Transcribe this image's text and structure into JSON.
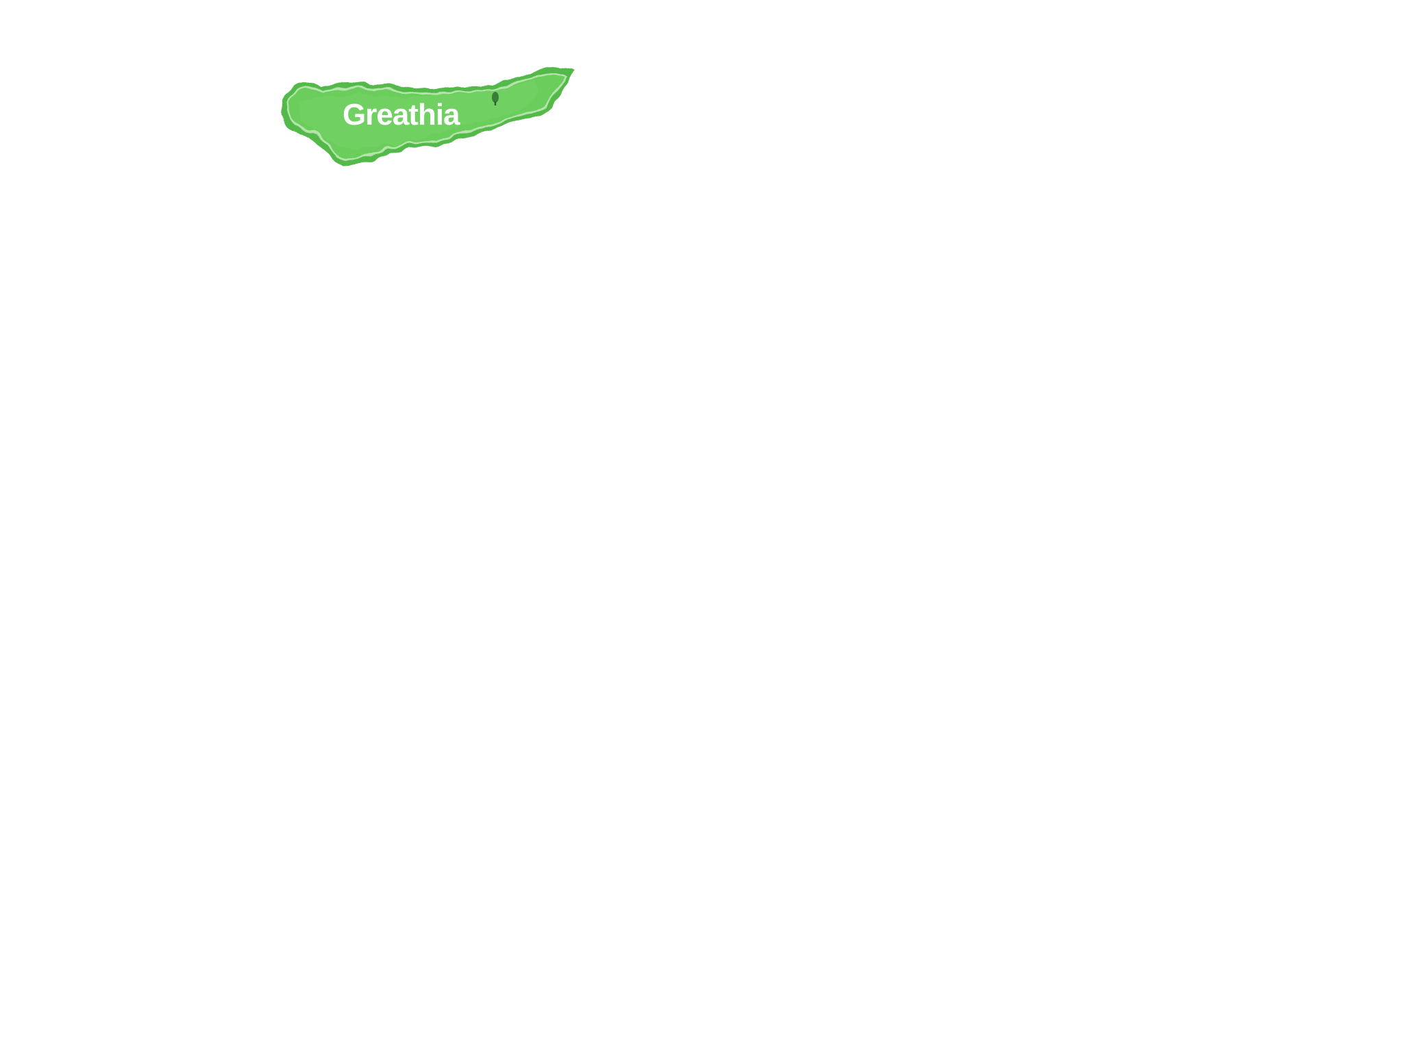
{
  "map": {
    "regions": [
      {
        "name": "Greathia",
        "fill_color": "#6acd5c",
        "border_color": "#52b94a",
        "halo_color": "#c8ecc0",
        "marker_icon": "tree-icon",
        "marker_color": "#3a7d38"
      }
    ]
  }
}
